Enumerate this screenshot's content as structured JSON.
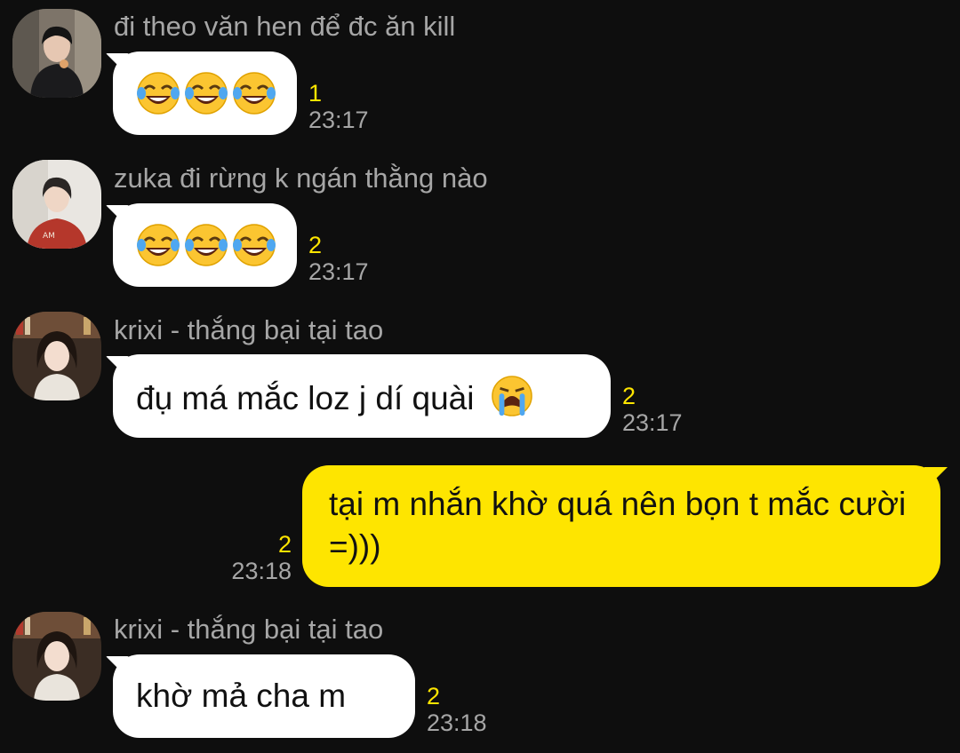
{
  "messages": [
    {
      "sender": "đi theo văn hen để đc ăn kill",
      "emoji": [
        "face-with-tears-of-joy",
        "face-with-tears-of-joy",
        "face-with-tears-of-joy"
      ],
      "unread": "1",
      "time": "23:17"
    },
    {
      "sender": "zuka đi rừng k ngán thằng nào",
      "emoji": [
        "face-with-tears-of-joy",
        "face-with-tears-of-joy",
        "face-with-tears-of-joy"
      ],
      "unread": "2",
      "time": "23:17"
    },
    {
      "sender": "krixi - thắng bại tại tao",
      "text": "đụ má mắc loz j dí quài",
      "emoji": [
        "loudly-crying-face"
      ],
      "unread": "2",
      "time": "23:17"
    },
    {
      "outgoing": true,
      "text": "tại m nhắn khờ quá nên bọn t mắc cười =)))",
      "unread": "2",
      "time": "23:18"
    },
    {
      "sender": "krixi - thắng bại tại tao",
      "text": "khờ mả cha m",
      "unread": "2",
      "time": "23:18"
    }
  ],
  "colors": {
    "background": "#0e0e0e",
    "incoming_bubble": "#ffffff",
    "outgoing_bubble": "#fee500",
    "unread_count": "#fee500",
    "meta_text": "#a6a6a6"
  }
}
